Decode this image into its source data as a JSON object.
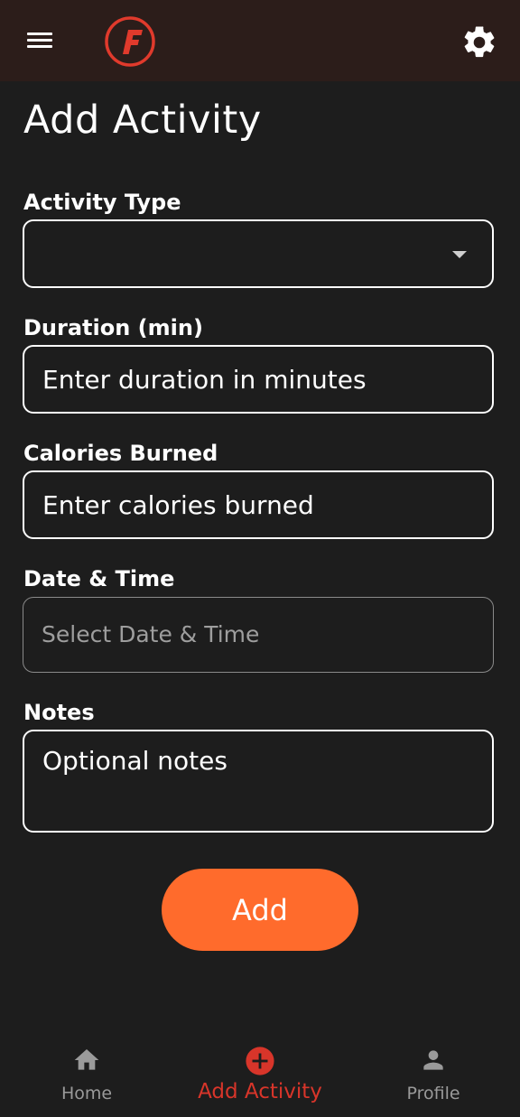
{
  "header": {
    "menu_icon": "hamburger-menu-icon",
    "logo_icon": "f-logo-icon",
    "settings_icon": "gear-icon"
  },
  "page": {
    "title": "Add Activity"
  },
  "form": {
    "activity_type": {
      "label": "Activity Type",
      "value": "",
      "icon": "dropdown-caret-icon"
    },
    "duration": {
      "label": "Duration (min)",
      "placeholder": "Enter duration in minutes"
    },
    "calories": {
      "label": "Calories Burned",
      "placeholder": "Enter calories burned"
    },
    "datetime": {
      "label": "Date & Time",
      "placeholder": "Select Date & Time"
    },
    "notes": {
      "label": "Notes",
      "placeholder": "Optional notes"
    },
    "submit_label": "Add"
  },
  "bottom_nav": {
    "items": [
      {
        "label": "Home",
        "icon": "home-icon",
        "active": false
      },
      {
        "label": "Add Activity",
        "icon": "add-circle-icon",
        "active": true
      },
      {
        "label": "Profile",
        "icon": "person-icon",
        "active": false
      }
    ]
  },
  "colors": {
    "background": "#1d1d1d",
    "topbar": "#2c1d1a",
    "accent": "#ff6b2c",
    "active_nav": "#d8352a",
    "inactive_nav": "#9a9a9a"
  }
}
